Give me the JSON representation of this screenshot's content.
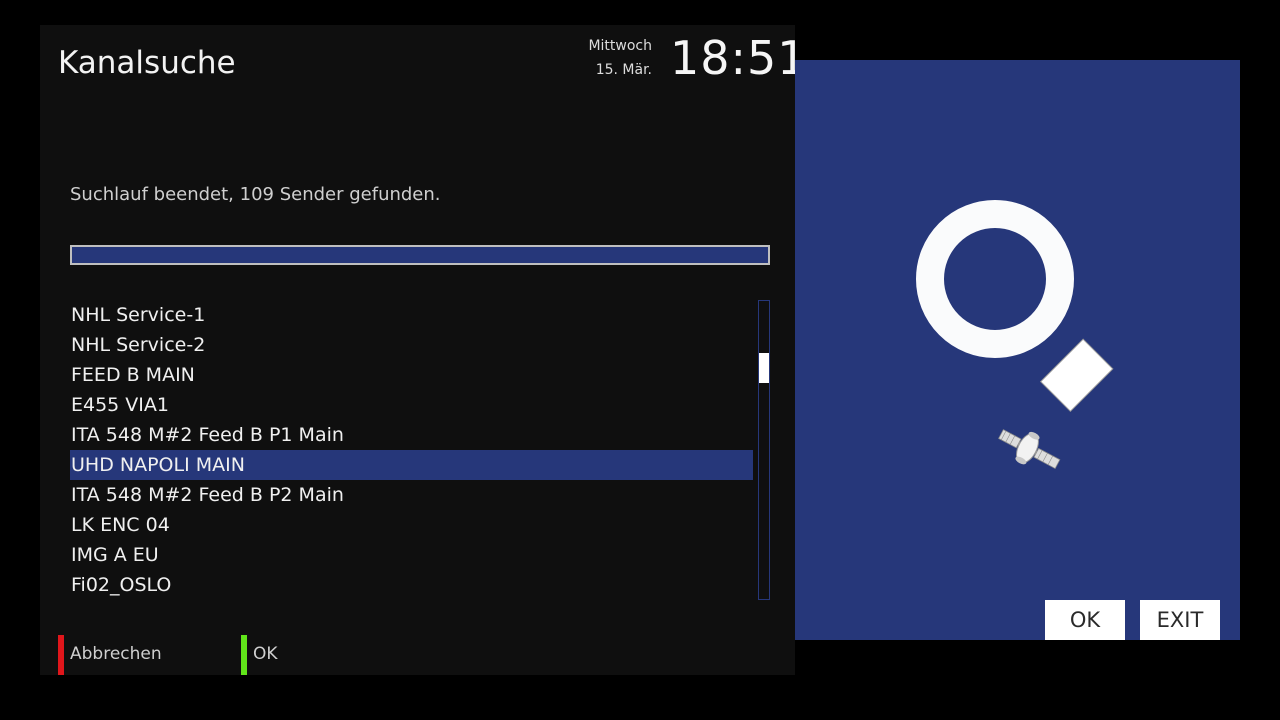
{
  "header": {
    "title": "Kanalsuche",
    "day": "Mittwoch",
    "date": "15. Mär.",
    "clock": "18:51"
  },
  "scan": {
    "status_text": "Suchlauf beendet, 109 Sender gefunden.",
    "progress_fraction": 1.0
  },
  "channels": [
    {
      "name": "NHL Service-1",
      "selected": false
    },
    {
      "name": "NHL Service-2",
      "selected": false
    },
    {
      "name": "FEED B MAIN",
      "selected": false
    },
    {
      "name": "E455 VIA1",
      "selected": false
    },
    {
      "name": "ITA 548 M#2 Feed B P1 Main",
      "selected": false
    },
    {
      "name": "UHD NAPOLI MAIN",
      "selected": true
    },
    {
      "name": "ITA 548 M#2 Feed B P2 Main",
      "selected": false
    },
    {
      "name": "LK ENC 04",
      "selected": false
    },
    {
      "name": "IMG A EU",
      "selected": false
    },
    {
      "name": "Fi02_OSLO",
      "selected": false
    }
  ],
  "footer": {
    "red_label": "Abbrechen",
    "green_label": "OK"
  },
  "side": {
    "ok_label": "OK",
    "exit_label": "EXIT"
  },
  "colors": {
    "accent": "#26377a",
    "red": "#e0161b",
    "green": "#61e51a"
  },
  "icons": {
    "search": "magnifier-icon",
    "satellite": "satellite-icon"
  }
}
